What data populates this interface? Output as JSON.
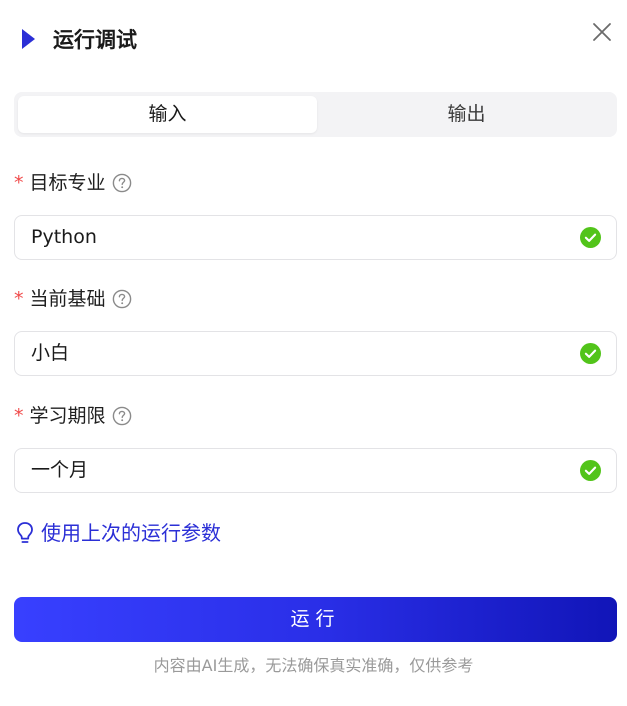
{
  "header": {
    "title": "运行调试",
    "play_icon": "play-icon",
    "close_icon": "close-icon"
  },
  "tabs": [
    {
      "label": "输入",
      "active": true
    },
    {
      "label": "输出",
      "active": false
    }
  ],
  "fields": [
    {
      "label": "目标专业",
      "required": true,
      "value": "Python",
      "valid": true
    },
    {
      "label": "当前基础",
      "required": true,
      "value": "小白",
      "valid": true
    },
    {
      "label": "学习期限",
      "required": true,
      "value": "一个月",
      "valid": true
    }
  ],
  "required_mark": "*",
  "reuse_link": {
    "label": "使用上次的运行参数",
    "icon": "lightbulb-icon"
  },
  "run_button": {
    "label": "运行"
  },
  "disclaimer": "内容由AI生成，无法确保真实准确，仅供参考",
  "colors": {
    "accent": "#2b2fd6",
    "success": "#52c41a",
    "required": "#f04a4a"
  }
}
